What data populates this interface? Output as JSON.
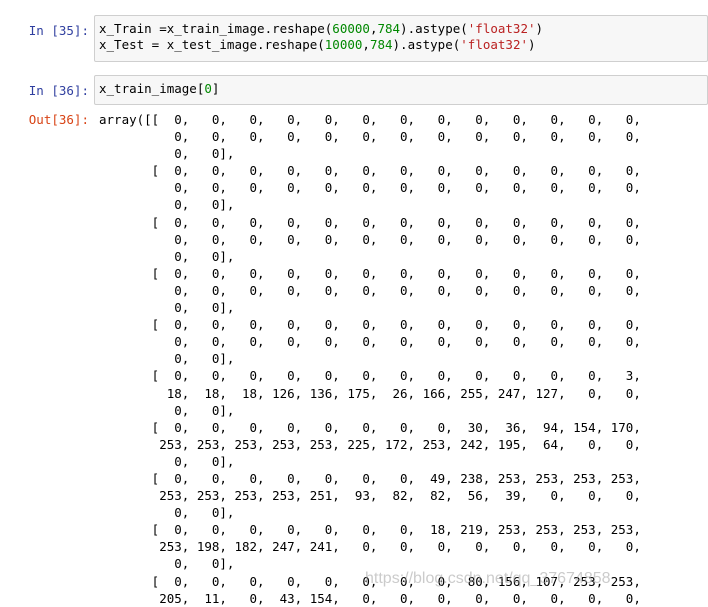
{
  "cells": [
    {
      "prompt": "In  [35]:",
      "lines": [
        [
          {
            "t": "x_Train =x_train_image.reshape("
          },
          {
            "t": "60000",
            "c": "num"
          },
          {
            "t": ","
          },
          {
            "t": "784",
            "c": "num"
          },
          {
            "t": ").astype("
          },
          {
            "t": "'float32'",
            "c": "str"
          },
          {
            "t": ")"
          }
        ],
        [
          {
            "t": "x_Test = x_test_image.reshape("
          },
          {
            "t": "10000",
            "c": "num"
          },
          {
            "t": ","
          },
          {
            "t": "784",
            "c": "num"
          },
          {
            "t": ").astype("
          },
          {
            "t": "'float32'",
            "c": "str"
          },
          {
            "t": ")"
          }
        ]
      ]
    },
    {
      "prompt": "In  [36]:",
      "lines": [
        [
          {
            "t": "x_train_image["
          },
          {
            "t": "0",
            "c": "num"
          },
          {
            "t": "]"
          }
        ]
      ]
    }
  ],
  "output": {
    "prompt": "Out[36]:",
    "lines": [
      "array([[  0,   0,   0,   0,   0,   0,   0,   0,   0,   0,   0,   0,   0,",
      "          0,   0,   0,   0,   0,   0,   0,   0,   0,   0,   0,   0,   0,",
      "          0,   0],",
      "       [  0,   0,   0,   0,   0,   0,   0,   0,   0,   0,   0,   0,   0,",
      "          0,   0,   0,   0,   0,   0,   0,   0,   0,   0,   0,   0,   0,",
      "          0,   0],",
      "       [  0,   0,   0,   0,   0,   0,   0,   0,   0,   0,   0,   0,   0,",
      "          0,   0,   0,   0,   0,   0,   0,   0,   0,   0,   0,   0,   0,",
      "          0,   0],",
      "       [  0,   0,   0,   0,   0,   0,   0,   0,   0,   0,   0,   0,   0,",
      "          0,   0,   0,   0,   0,   0,   0,   0,   0,   0,   0,   0,   0,",
      "          0,   0],",
      "       [  0,   0,   0,   0,   0,   0,   0,   0,   0,   0,   0,   0,   0,",
      "          0,   0,   0,   0,   0,   0,   0,   0,   0,   0,   0,   0,   0,",
      "          0,   0],",
      "       [  0,   0,   0,   0,   0,   0,   0,   0,   0,   0,   0,   0,   3,",
      "         18,  18,  18, 126, 136, 175,  26, 166, 255, 247, 127,   0,   0,",
      "          0,   0],",
      "       [  0,   0,   0,   0,   0,   0,   0,   0,  30,  36,  94, 154, 170,",
      "        253, 253, 253, 253, 253, 225, 172, 253, 242, 195,  64,   0,   0,",
      "          0,   0],",
      "       [  0,   0,   0,   0,   0,   0,   0,  49, 238, 253, 253, 253, 253,",
      "        253, 253, 253, 253, 251,  93,  82,  82,  56,  39,   0,   0,   0,",
      "          0,   0],",
      "       [  0,   0,   0,   0,   0,   0,   0,  18, 219, 253, 253, 253, 253,",
      "        253, 198, 182, 247, 241,   0,   0,   0,   0,   0,   0,   0,   0,",
      "          0,   0],",
      "       [  0,   0,   0,   0,   0,   0,   0,   0,  80, 156, 107, 253, 253,",
      "        205,  11,   0,  43, 154,   0,   0,   0,   0,   0,   0,   0,   0,"
    ]
  },
  "watermark": "https://blog.csdn.net/qq_37674858"
}
